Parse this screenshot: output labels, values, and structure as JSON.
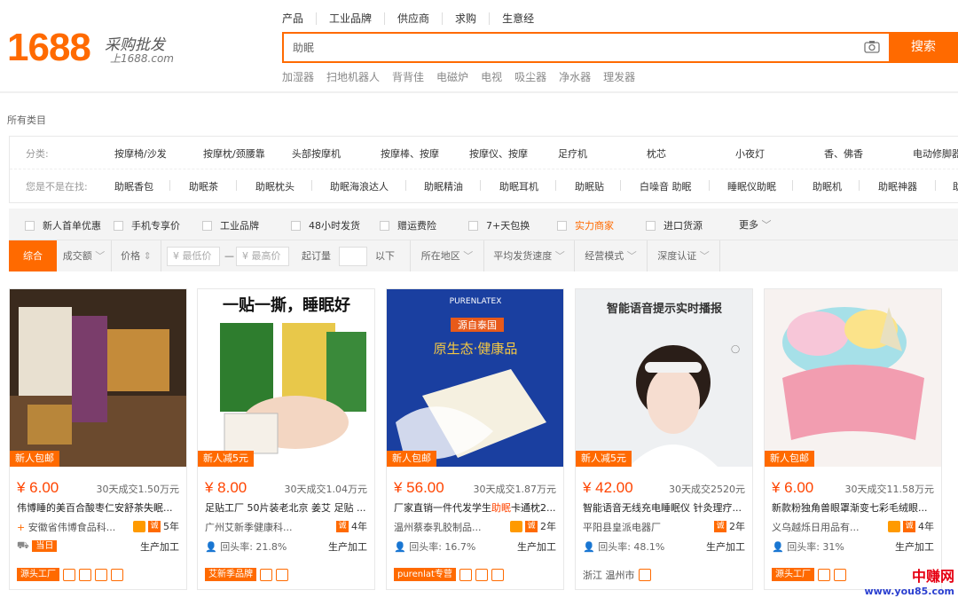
{
  "logo": {
    "number": "1688",
    "slogan": "采购批发",
    "domain": "上1688.com"
  },
  "search": {
    "tabs": [
      "产品",
      "工业品牌",
      "供应商",
      "求购",
      "生意经"
    ],
    "query": "助眠",
    "button": "搜索",
    "hot_words": [
      "加湿器",
      "扫地机器人",
      "背背佳",
      "电磁炉",
      "电视",
      "吸尘器",
      "净水器",
      "理发器"
    ]
  },
  "all_categories": "所有类目",
  "categories": {
    "label": "分类:",
    "items": [
      "按摩椅/沙发",
      "按摩枕/颈腰靠",
      "头部按摩机",
      "按摩棒、按摩",
      "按摩仪、按摩",
      "足疗机",
      "枕芯",
      "小夜灯",
      "香、佛香",
      "电动修脚器"
    ]
  },
  "related": {
    "label": "您是不是在找:",
    "items": [
      "助眠香包",
      "助眠茶",
      "助眠枕头",
      "助眠海浪达人",
      "助眠精油",
      "助眠耳机",
      "助眠贴",
      "白噪音 助眠",
      "睡眠仪助眠",
      "助眠机",
      "助眠神器",
      "助"
    ]
  },
  "filters": {
    "checks": [
      "新人首单优惠",
      "手机专享价",
      "工业品牌",
      "48小时发货",
      "赠运费险",
      "7+天包换",
      "实力商家",
      "进口货源"
    ],
    "more": "更多"
  },
  "sort": {
    "default": "综合",
    "volume": "成交额",
    "price": "价格",
    "min_price": "¥ 最低价",
    "dash": "—",
    "max_price": "¥ 最高价",
    "moq": "起订量",
    "below": "以下",
    "region": "所在地区",
    "shipping": "平均发货速度",
    "business": "经营模式",
    "certification": "深度认证"
  },
  "products": [
    {
      "badge": "新人包邮",
      "price": "¥ 6.00",
      "sales": "30天成交1.50万元",
      "title_pre": "伟博睡的美百合酸枣仁安舒茶失眠...",
      "title_hl": "",
      "title_post": "",
      "company": "安徽省伟博食品科...",
      "years": "5年",
      "repurchase": "当日",
      "mode": "生产加工",
      "tag": "源头工厂"
    },
    {
      "badge": "新人减5元",
      "price": "¥ 8.00",
      "sales": "30天成交1.04万元",
      "title_pre": "足贴工厂 50片装老北京 姜艾 足贴 ...",
      "title_hl": "",
      "title_post": "",
      "company": "广州艾新季健康科...",
      "years": "4年",
      "repurchase": "回头率: 21.8%",
      "mode": "生产加工",
      "tag": "艾新季品牌"
    },
    {
      "badge": "新人包邮",
      "price": "¥ 56.00",
      "sales": "30天成交1.87万元",
      "title_pre": "厂家直销一件代发学生",
      "title_hl": "助眠",
      "title_post": "卡通枕2...",
      "company": "温州蔡泰乳胶制品...",
      "years": "2年",
      "repurchase": "回头率: 16.7%",
      "mode": "生产加工",
      "tag": "purenlat专营"
    },
    {
      "badge": "新人减5元",
      "price": "¥ 42.00",
      "sales": "30天成交2520元",
      "title_pre": "智能语音无线充电睡眠仪 针灸理疗...",
      "title_hl": "",
      "title_post": "",
      "company": "平阳县皇派电器厂",
      "years": "2年",
      "repurchase": "回头率: 48.1%",
      "mode": "生产加工",
      "tag": "浙江 温州市"
    },
    {
      "badge": "新人包邮",
      "price": "¥ 6.00",
      "sales": "30天成交11.58万元",
      "title_pre": "新款粉独角兽眼罩渐变七彩毛绒眼...",
      "title_hl": "",
      "title_post": "",
      "company": "义乌越烁日用品有...",
      "years": "4年",
      "repurchase": "回头率: 31%",
      "mode": "生产加工",
      "tag": "源头工厂"
    }
  ],
  "image_text": {
    "p2_banner": "一贴一撕，睡眠好",
    "p3_brand": "PURENLATEX",
    "p3_line1": "源自泰国",
    "p3_line2": "原生态·健康品",
    "p4_headline": "智能语音提示实时播报"
  },
  "watermark": {
    "cn": "中赚网",
    "url": "www.you85.com"
  },
  "colors": {
    "accent": "#ff6a00",
    "price": "#ff4400"
  }
}
